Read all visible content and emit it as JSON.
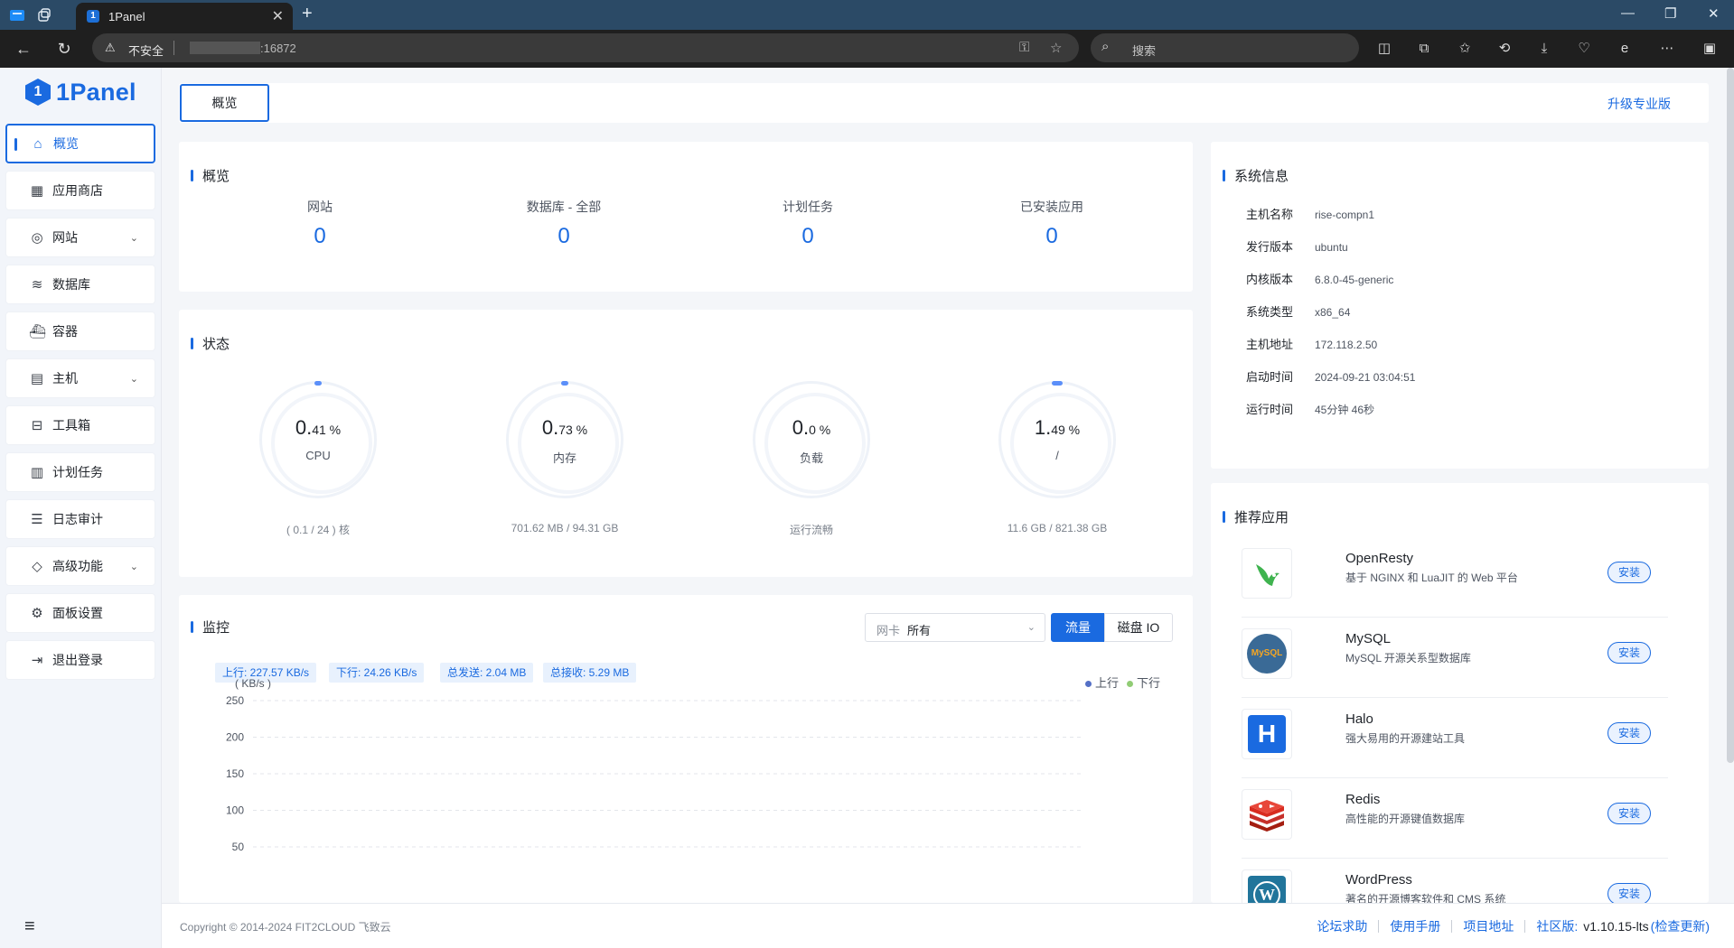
{
  "browser": {
    "tab_title": "1Panel",
    "tab_logo_letter": "1",
    "insecure_label": "不安全",
    "url_host": ":16872",
    "search_placeholder": "搜索"
  },
  "sidebar": {
    "logo_text": "1Panel",
    "logo_mark": "1",
    "items": [
      {
        "label": "概览",
        "icon": "home-icon"
      },
      {
        "label": "应用商店",
        "icon": "grid-icon"
      },
      {
        "label": "网站",
        "icon": "globe-icon"
      },
      {
        "label": "数据库",
        "icon": "layers-icon"
      },
      {
        "label": "容器",
        "icon": "docker-icon"
      },
      {
        "label": "主机",
        "icon": "server-icon"
      },
      {
        "label": "工具箱",
        "icon": "toolbox-icon"
      },
      {
        "label": "计划任务",
        "icon": "calendar-icon"
      },
      {
        "label": "日志审计",
        "icon": "log-icon"
      },
      {
        "label": "高级功能",
        "icon": "diamond-icon"
      },
      {
        "label": "面板设置",
        "icon": "gear-icon"
      },
      {
        "label": "退出登录",
        "icon": "logout-icon"
      }
    ]
  },
  "topnav": {
    "tab_label": "概览",
    "upgrade_label": "升级专业版"
  },
  "overview": {
    "title": "概览",
    "stats": [
      {
        "label": "网站",
        "value": "0"
      },
      {
        "label": "数据库 - 全部",
        "value": "0"
      },
      {
        "label": "计划任务",
        "value": "0"
      },
      {
        "label": "已安装应用",
        "value": "0"
      }
    ]
  },
  "status": {
    "title": "状态",
    "gauges": [
      {
        "int": "0.",
        "dec": "41 %",
        "label": "CPU",
        "sub": "( 0.1 / 24 ) 核",
        "percent": 0.41
      },
      {
        "int": "0.",
        "dec": "73 %",
        "label": "内存",
        "sub": "701.62 MB / 94.31 GB",
        "percent": 0.73
      },
      {
        "int": "0.",
        "dec": "0 %",
        "label": "负载",
        "sub": "运行流畅",
        "percent": 0.0
      },
      {
        "int": "1.",
        "dec": "49 %",
        "label": "/",
        "sub": "11.6 GB / 821.38 GB",
        "percent": 1.49
      }
    ]
  },
  "monitor": {
    "title": "监控",
    "nic_label": "网卡",
    "nic_value": "所有",
    "btn_traffic": "流量",
    "btn_disk": "磁盘 IO",
    "chips": [
      "上行: 227.57 KB/s",
      "下行: 24.26 KB/s",
      "总发送: 2.04 MB",
      "总接收: 5.29 MB"
    ],
    "legend_up": "上行",
    "legend_down": "下行"
  },
  "chart_data": {
    "type": "line",
    "ylabel": "( KB/s )",
    "yticks": [
      "250",
      "200",
      "150",
      "100",
      "50"
    ],
    "ylim": [
      50,
      250
    ],
    "grid": true,
    "legend_position": "top-right",
    "series": [
      {
        "name": "上行",
        "color": "#5470c6",
        "values": []
      },
      {
        "name": "下行",
        "color": "#91cc75",
        "values": []
      }
    ]
  },
  "sysinfo": {
    "title": "系统信息",
    "rows": [
      {
        "k": "主机名称",
        "v": "rise-compn1"
      },
      {
        "k": "发行版本",
        "v": "ubuntu"
      },
      {
        "k": "内核版本",
        "v": "6.8.0-45-generic"
      },
      {
        "k": "系统类型",
        "v": "x86_64"
      },
      {
        "k": "主机地址",
        "v": "172.118.2.50"
      },
      {
        "k": "启动时间",
        "v": "2024-09-21 03:04:51"
      },
      {
        "k": "运行时间",
        "v": "45分钟 46秒"
      }
    ]
  },
  "recommend": {
    "title": "推荐应用",
    "install_label": "安装",
    "apps": [
      {
        "name": "OpenResty",
        "desc": "基于 NGINX 和 LuaJIT 的 Web 平台",
        "icon": "openresty-icon"
      },
      {
        "name": "MySQL",
        "desc": "MySQL 开源关系型数据库",
        "icon": "mysql-icon",
        "icon_text": "MySQL"
      },
      {
        "name": "Halo",
        "desc": "强大易用的开源建站工具",
        "icon": "halo-icon",
        "icon_text": "H"
      },
      {
        "name": "Redis",
        "desc": "高性能的开源键值数据库",
        "icon": "redis-icon"
      },
      {
        "name": "WordPress",
        "desc": "著名的开源博客软件和 CMS 系统",
        "icon": "wordpress-icon",
        "icon_text": "W"
      }
    ]
  },
  "footer": {
    "copyright": "Copyright © 2014-2024 FIT2CLOUD 飞致云",
    "forum": "论坛求助",
    "manual": "使用手册",
    "project": "项目地址",
    "edition": "社区版:",
    "version": "v1.10.15-lts",
    "check_update": "(检查更新)"
  }
}
